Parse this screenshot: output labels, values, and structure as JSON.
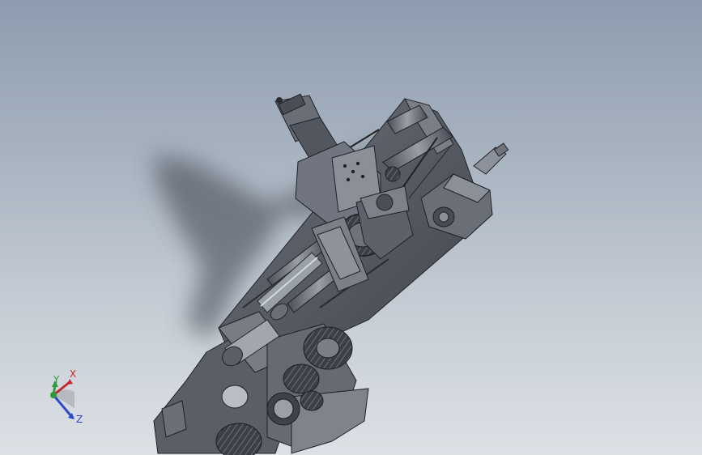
{
  "viewport": {
    "background_top": "#8d9caf",
    "background_bottom": "#dde1e6",
    "model_color": "#5b5f68",
    "model_dark": "#2f3238",
    "model_light": "#8a8e96"
  },
  "triad": {
    "x_label": "X",
    "y_label": "Y",
    "z_label": "Z",
    "x_color": "#c0282b",
    "y_color": "#2e9a3a",
    "z_color": "#2f48c9"
  }
}
